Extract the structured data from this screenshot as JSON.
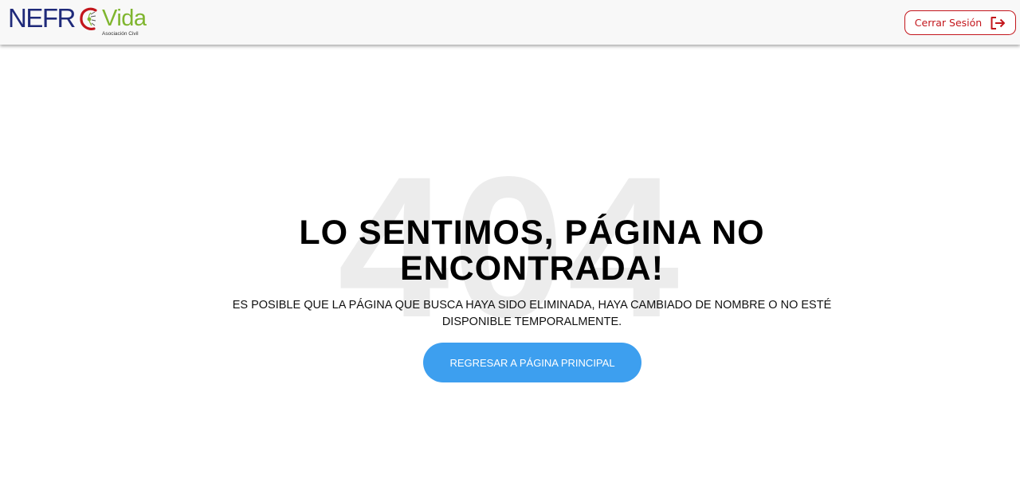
{
  "header": {
    "logo": {
      "brand_left": "NEFR",
      "brand_right": "Vida",
      "subtitle": "Asociación Civil"
    },
    "logout_button": {
      "label": "Cerrar Sesión",
      "icon": "logout-icon"
    }
  },
  "error": {
    "code": "404",
    "headline": "LO SENTIMOS, PÁGINA NO ENCONTRADA!",
    "message": "ES POSIBLE QUE LA PÁGINA QUE BUSCA HAYA SIDO ELIMINADA, HAYA CAMBIADO DE NOMBRE O NO ESTÉ DISPONIBLE TEMPORALMENTE.",
    "home_button_label": "REGRESAR A PÁGINA PRINCIPAL"
  },
  "colors": {
    "brand_blue": "#1f2a7a",
    "brand_red": "#c3161c",
    "brand_green": "#7fb52e",
    "button_blue": "#3d9fef",
    "code_watermark": "#ececec"
  }
}
